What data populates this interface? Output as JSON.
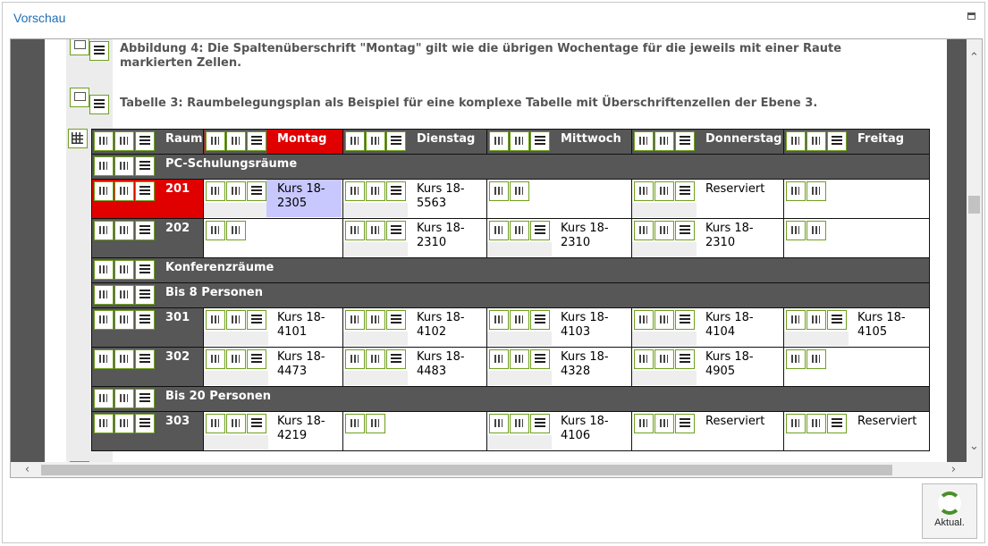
{
  "window": {
    "title": "Vorschau"
  },
  "captions": {
    "fig4": "Abbildung 4: Die Spaltenüberschrift \"Montag\" gilt wie die übrigen Wochentage für die jeweils mit einer Raute markierten Zellen.",
    "tab3": "Tabelle 3: Raumbelegungsplan als Beispiel für eine komplexe Tabelle mit Überschriftenzellen der Ebene 3."
  },
  "table": {
    "headers": [
      "Raum",
      "Montag",
      "Dienstag",
      "Mittwoch",
      "Donnerstag",
      "Freitag"
    ],
    "groups": {
      "pc": "PC-Schulungsräume",
      "konf": "Konferenzräume",
      "bis8": "Bis 8 Personen",
      "bis20": "Bis 20 Personen"
    },
    "rows": {
      "r201": {
        "room": "201",
        "mo": "Kurs 18-2305",
        "di": "Kurs 18-5563",
        "mi": "",
        "do": "Reserviert",
        "fr": ""
      },
      "r202": {
        "room": "202",
        "mo": "",
        "di": "Kurs 18-2310",
        "mi": "Kurs 18-2310",
        "do": "Kurs 18-2310",
        "fr": ""
      },
      "r301": {
        "room": "301",
        "mo": "Kurs 18-4101",
        "di": "Kurs 18-4102",
        "mi": "Kurs 18-4103",
        "do": "Kurs 18-4104",
        "fr": "Kurs 18-4105"
      },
      "r302": {
        "room": "302",
        "mo": "Kurs 18-4473",
        "di": "Kurs 18-4483",
        "mi": "Kurs 18-4328",
        "do": "Kurs 18-4905",
        "fr": ""
      },
      "r303": {
        "room": "303",
        "mo": "Kurs 18-4219",
        "di": "",
        "mi": "Kurs 18-4106",
        "do": "Reserviert",
        "fr": "Reserviert"
      }
    }
  },
  "buttons": {
    "refresh": "Aktual."
  },
  "colors": {
    "accent": "#1f6fb5",
    "highlight_red": "#e00000",
    "icon_green": "#6f9f1f"
  }
}
